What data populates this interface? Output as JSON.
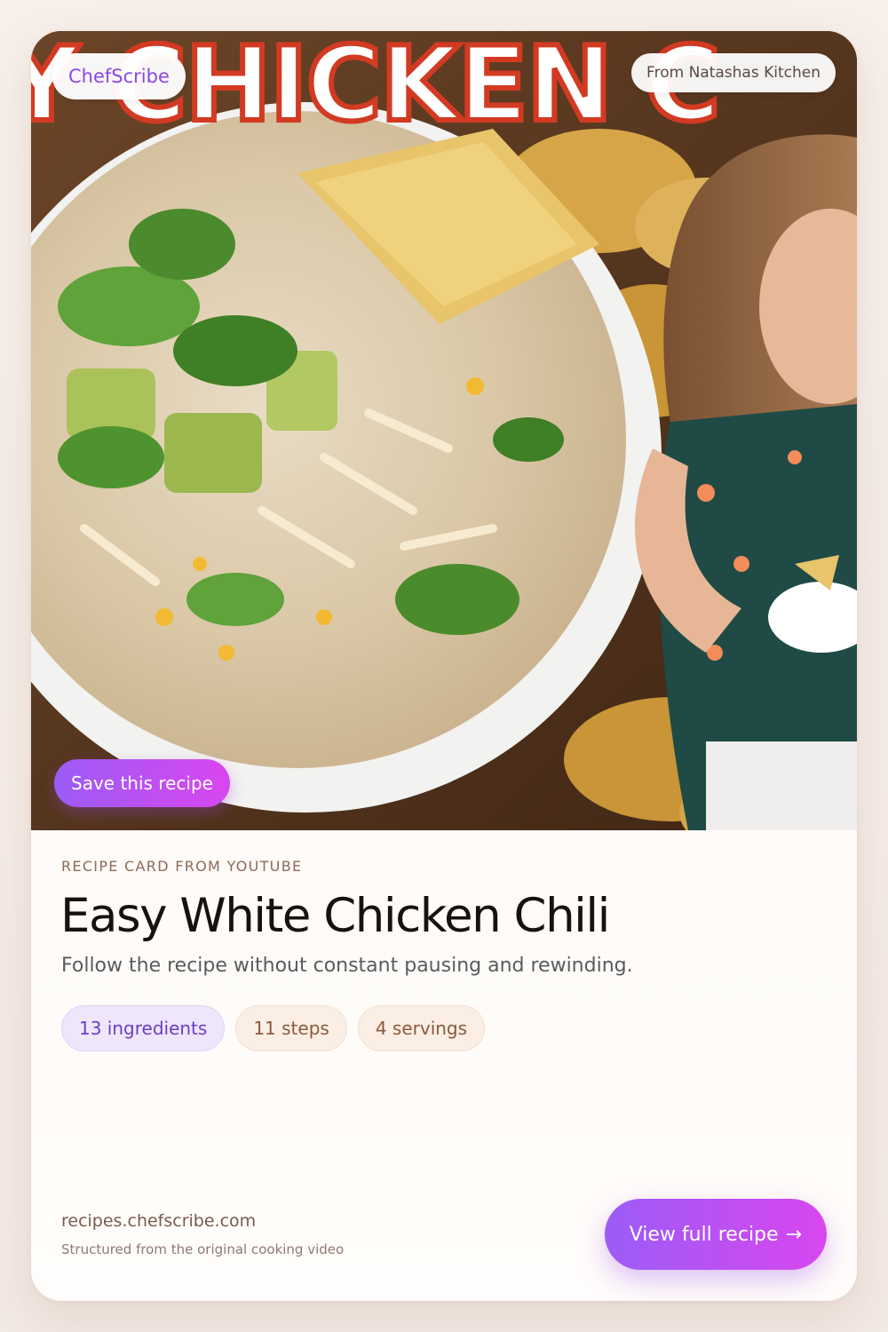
{
  "hero": {
    "banner_text": "Y CHICKEN C",
    "brand_label": "ChefScribe",
    "source_label": "From Natashas Kitchen",
    "save_label": "Save this recipe"
  },
  "recipe": {
    "eyebrow": "RECIPE CARD FROM YOUTUBE",
    "title": "Easy White Chicken Chili",
    "subtitle": "Follow the recipe without constant pausing and rewinding.",
    "stats": {
      "ingredients": "13 ingredients",
      "steps": "11 steps",
      "servings": "4 servings"
    }
  },
  "footer": {
    "domain": "recipes.chefscribe.com",
    "note": "Structured from the original cooking video",
    "cta_label": "View full recipe",
    "cta_arrow": "→"
  },
  "colors": {
    "accent_start": "#9b5cf6",
    "accent_end": "#d946ef",
    "brand_text": "#8b48e6",
    "title_text": "#17120f"
  },
  "icons": {
    "cta_arrow": "arrow-right-icon"
  }
}
